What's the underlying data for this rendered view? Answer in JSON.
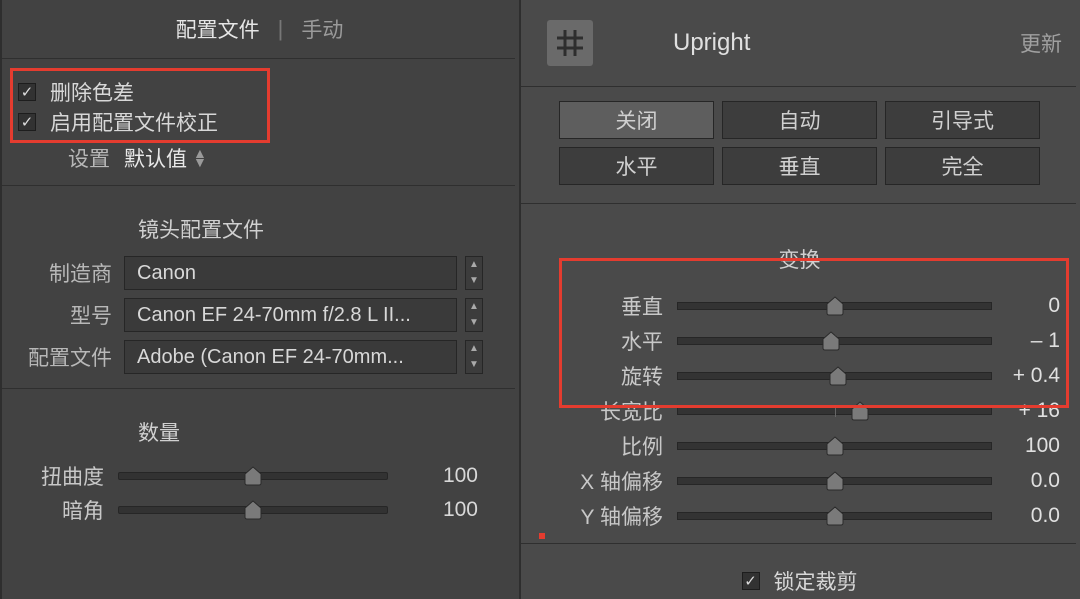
{
  "left": {
    "tabs": {
      "profile": "配置文件",
      "manual": "手动"
    },
    "checkboxes": {
      "remove_chromatic": "删除色差",
      "enable_profile": "启用配置文件校正"
    },
    "settings_label": "设置",
    "settings_value": "默认值",
    "lens_profile_title": "镜头配置文件",
    "manufacturer_label": "制造商",
    "manufacturer_value": "Canon",
    "model_label": "型号",
    "model_value": "Canon EF 24-70mm f/2.8 L II...",
    "profile_label": "配置文件",
    "profile_value": "Adobe (Canon EF 24-70mm...",
    "amount_title": "数量",
    "sliders": [
      {
        "label": "扭曲度",
        "value": "100",
        "pos": 50
      },
      {
        "label": "暗角",
        "value": "100",
        "pos": 50
      }
    ]
  },
  "right": {
    "title": "Upright",
    "update": "更新",
    "seg1": [
      "关闭",
      "自动",
      "引导式"
    ],
    "seg2": [
      "水平",
      "垂直",
      "完全"
    ],
    "transform_title": "变换",
    "sliders": [
      {
        "label": "垂直",
        "value": "0",
        "pos": 50
      },
      {
        "label": "水平",
        "value": "– 1",
        "pos": 49
      },
      {
        "label": "旋转",
        "value": "+ 0.4",
        "pos": 51
      },
      {
        "label": "长宽比",
        "value": "+ 16",
        "pos": 58
      },
      {
        "label": "比例",
        "value": "100",
        "pos": 50
      },
      {
        "label": "X 轴偏移",
        "value": "0.0",
        "pos": 50
      },
      {
        "label": "Y 轴偏移",
        "value": "0.0",
        "pos": 50
      }
    ],
    "lock_crop": "锁定裁剪"
  }
}
